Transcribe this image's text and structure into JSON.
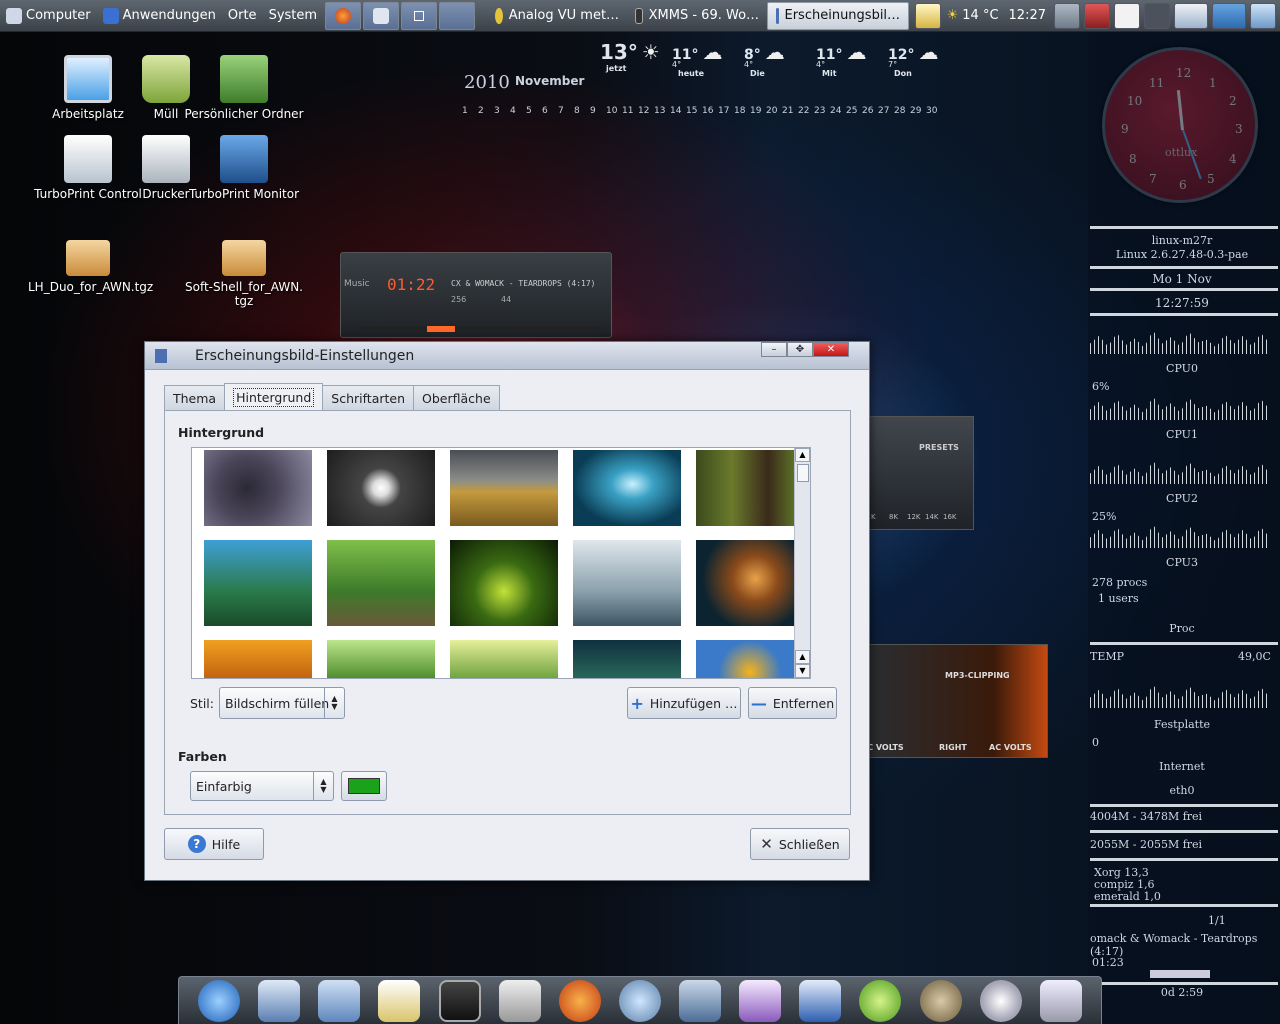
{
  "topbar": {
    "computer": "Computer",
    "applications": "Anwendungen",
    "places": "Orte",
    "system": "System",
    "tasks": [
      "Analog VU met…",
      "XMMS - 69. Wo…",
      "Erscheinungsbil…"
    ],
    "weather": "14 °C",
    "time": "12:27"
  },
  "desktop": {
    "icons": [
      "Arbeitsplatz",
      "Müll",
      "Persönlicher Ordner",
      "TurboPrint Control",
      "Drucker",
      "TurboPrint Monitor",
      "LH_Duo_for_AWN.tgz",
      "Soft-Shell_for_AWN.\ntgz"
    ]
  },
  "calendar": {
    "year": "2010",
    "month": "November",
    "days": [
      "1",
      "2",
      "3",
      "4",
      "5",
      "6",
      "7",
      "8",
      "9",
      "10",
      "11",
      "12",
      "13",
      "14",
      "15",
      "16",
      "17",
      "18",
      "19",
      "20",
      "21",
      "22",
      "23",
      "24",
      "25",
      "26",
      "27",
      "28",
      "29",
      "30"
    ]
  },
  "forecast": [
    {
      "temp": "13°",
      "label": "jetzt"
    },
    {
      "temp": "11°",
      "low": "4°",
      "label": "heute"
    },
    {
      "temp": "8°",
      "low": "4°",
      "label": "Die"
    },
    {
      "temp": "11°",
      "low": "4°",
      "label": "Mit"
    },
    {
      "temp": "12°",
      "low": "7°",
      "label": "Don"
    }
  ],
  "player": {
    "source": "Music",
    "time": "01:22",
    "track": "CX & WOMACK - TEARDROPS (4:17)",
    "bitrate": "256",
    "khz": "44"
  },
  "eq": {
    "presets": "PRESETS",
    "bands": [
      "K",
      "8K",
      "12K",
      "14K",
      "16K"
    ]
  },
  "vu": {
    "clipping": "MP3-CLIPPING",
    "right": "RIGHT",
    "acvolts": "AC VOLTS",
    "acvolts_left": "AC VOLTS"
  },
  "sysmon": {
    "clock_brand": "ottlux",
    "host": "linux-m27r",
    "kernel": "Linux 2.6.27.48-0.3-pae",
    "date": "Mo  1 Nov",
    "clock": "12:27:59",
    "cpu": [
      "CPU0",
      "CPU1",
      "CPU2",
      "CPU3"
    ],
    "cpu1_pct": "6%",
    "cpu3_pct": "25%",
    "procs": "278 procs",
    "users": "1 users",
    "proc": "Proc",
    "temp_label": "TEMP",
    "temp_val": "49,0C",
    "disk": "Festplatte",
    "net_zero": "0",
    "internet": "Internet",
    "iface": "eth0",
    "mem1": "4004M - 3478M frei",
    "mem2": "2055M - 2055M frei",
    "xorg": "Xorg 13,3",
    "compiz": "compiz  1,6",
    "emerald": "emerald  1,0",
    "counter": "1/1",
    "song": "omack & Womack - Teardrops (4:17)",
    "elapsed": "01:23",
    "uptime": "0d  2:59"
  },
  "dialog": {
    "title": "Erscheinungsbild-Einstellungen",
    "tabs": [
      "Thema",
      "Hintergrund",
      "Schriftarten",
      "Oberfläche"
    ],
    "section_bg": "Hintergrund",
    "style_label": "Stil:",
    "style_value": "Bildschirm füllen",
    "add": "Hinzufügen …",
    "remove": "Entfernen",
    "section_colors": "Farben",
    "color_mode": "Einfarbig",
    "color_value": "#1aa31a",
    "help": "Hilfe",
    "close": "Schließen"
  },
  "colors": {
    "accent": "#c41616",
    "selection": "#1aa31a"
  }
}
